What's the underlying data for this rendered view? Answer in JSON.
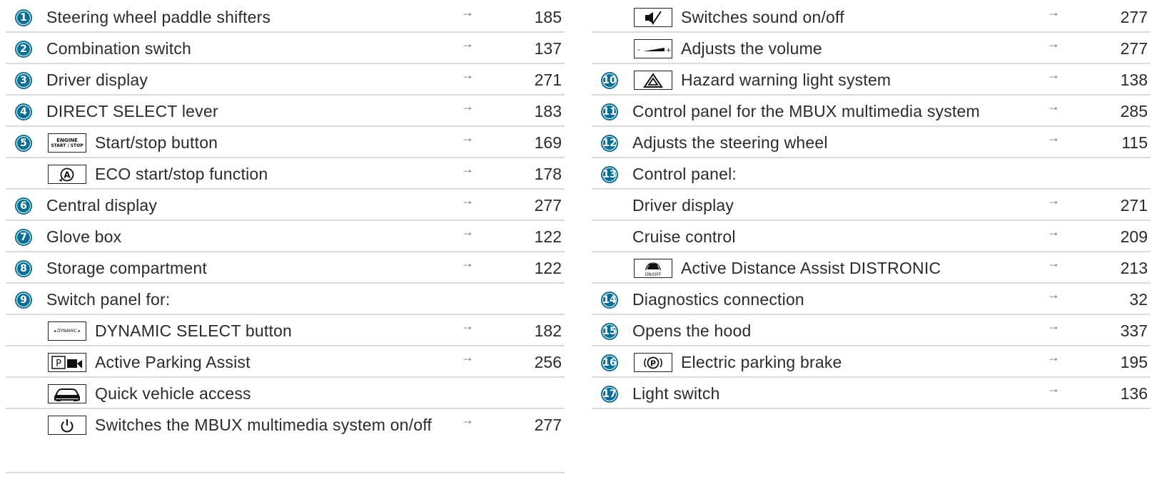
{
  "left": [
    {
      "badge": "1",
      "label": "Steering wheel paddle shifters",
      "page": "185"
    },
    {
      "badge": "2",
      "label": "Combination switch",
      "page": "137"
    },
    {
      "badge": "3",
      "label": "Driver display",
      "page": "271"
    },
    {
      "badge": "4",
      "label": "DIRECT SELECT lever",
      "page": "183"
    },
    {
      "badge": "5",
      "icon": "engine-start-stop-icon",
      "icon_text": [
        "ENGINE",
        "START / STOP"
      ],
      "label": "Start/stop button",
      "page": "169"
    },
    {
      "icon": "eco-start-stop-icon",
      "label": "ECO start/stop function",
      "page": "178"
    },
    {
      "badge": "6",
      "label": "Central display",
      "page": "277"
    },
    {
      "badge": "7",
      "label": "Glove box",
      "page": "122"
    },
    {
      "badge": "8",
      "label": "Storage compartment",
      "page": "122"
    },
    {
      "badge": "9",
      "label": "Switch panel for:",
      "page": ""
    },
    {
      "icon": "dynamic-select-icon",
      "icon_text": [
        "◂ DYNAMIC ▸"
      ],
      "label": "DYNAMIC SELECT button",
      "page": "182"
    },
    {
      "icon": "parking-assist-icon",
      "label": "Active Parking Assist",
      "page": "256"
    },
    {
      "icon": "vehicle-access-icon",
      "label": "Quick vehicle access",
      "page": ""
    },
    {
      "icon": "power-icon",
      "label": "Switches the MBUX multimedia system on/off",
      "page": "277",
      "tall": true
    }
  ],
  "right": [
    {
      "icon": "mute-icon",
      "label": "Switches sound on/off",
      "page": "277"
    },
    {
      "icon": "volume-icon",
      "label": "Adjusts the volume",
      "page": "277"
    },
    {
      "badge": "10",
      "icon": "hazard-icon",
      "label": "Hazard warning light system",
      "page": "138"
    },
    {
      "badge": "11",
      "label": "Control panel for the MBUX multimedia system",
      "page": "285"
    },
    {
      "badge": "12",
      "label": "Adjusts the steering wheel",
      "page": "115"
    },
    {
      "badge": "13",
      "label": "Control panel:",
      "page": ""
    },
    {
      "indent": true,
      "label": "Driver display",
      "page": "271"
    },
    {
      "indent": true,
      "label": "Cruise control",
      "page": "209"
    },
    {
      "icon": "distronic-icon",
      "label": "Active Distance Assist DISTRONIC",
      "page": "213"
    },
    {
      "badge": "14",
      "label": "Diagnostics connection",
      "page": "32"
    },
    {
      "badge": "15",
      "label": "Opens the hood",
      "page": "337"
    },
    {
      "badge": "16",
      "icon": "parking-brake-icon",
      "label": "Electric parking brake",
      "page": "195"
    },
    {
      "badge": "17",
      "label": "Light switch",
      "page": "136"
    }
  ],
  "arrow_glyph": "→",
  "colors": {
    "badge": "#0a6f93",
    "divider": "#dadada",
    "text": "#2b2b2b"
  }
}
